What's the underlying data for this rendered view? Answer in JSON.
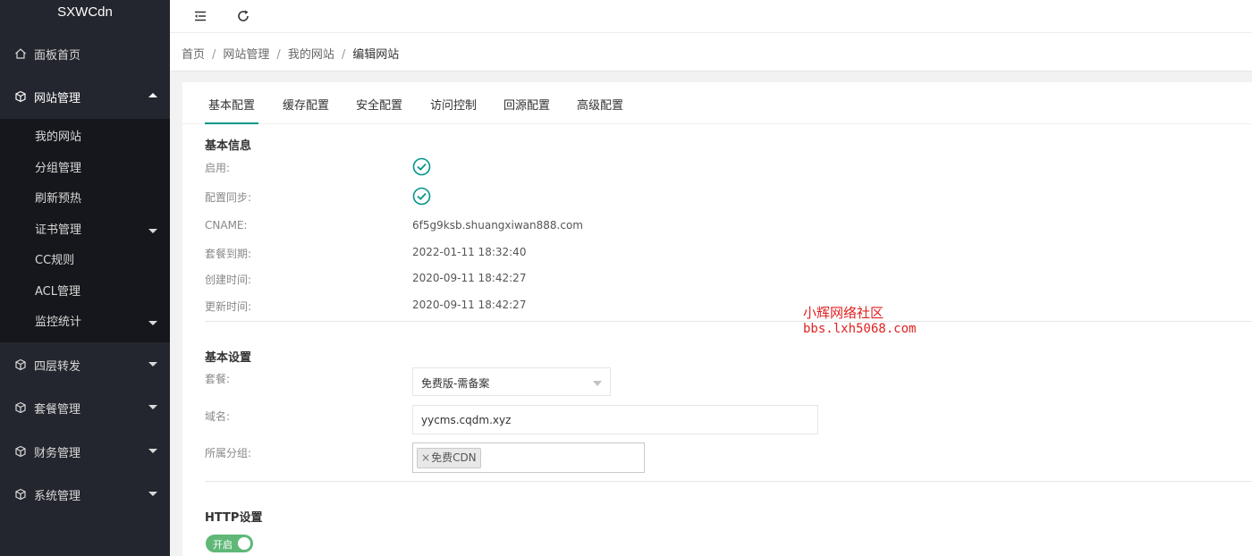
{
  "app": {
    "title": "SXWCdn"
  },
  "sidebar": {
    "items": [
      {
        "label": "面板首页",
        "icon": "home-icon"
      },
      {
        "label": "网站管理",
        "icon": "cube-icon",
        "expanded": true
      },
      {
        "label": "四层转发",
        "icon": "cube-icon"
      },
      {
        "label": "套餐管理",
        "icon": "cube-icon"
      },
      {
        "label": "财务管理",
        "icon": "cube-icon"
      },
      {
        "label": "系统管理",
        "icon": "cube-icon"
      }
    ],
    "submenu": [
      {
        "label": "我的网站"
      },
      {
        "label": "分组管理"
      },
      {
        "label": "刷新预热"
      },
      {
        "label": "证书管理",
        "has_children": true
      },
      {
        "label": "CC规则"
      },
      {
        "label": "ACL管理"
      },
      {
        "label": "监控统计",
        "has_children": true
      }
    ]
  },
  "header": {
    "icons": [
      "menu-fold-icon",
      "refresh-icon"
    ]
  },
  "breadcrumb": [
    "首页",
    "网站管理",
    "我的网站",
    "编辑网站"
  ],
  "tabs": [
    "基本配置",
    "缓存配置",
    "安全配置",
    "访问控制",
    "回源配置",
    "高级配置"
  ],
  "basic_info": {
    "title": "基本信息",
    "enabled_label": "启用:",
    "sync_label": "配置同步:",
    "cname_label": "CNAME:",
    "cname_value": "6f5g9ksb.shuangxiwan888.com",
    "expire_label": "套餐到期:",
    "expire_value": "2022-01-11 18:32:40",
    "created_label": "创建时间:",
    "created_value": "2020-09-11 18:42:27",
    "updated_label": "更新时间:",
    "updated_value": "2020-09-11 18:42:27"
  },
  "basic_settings": {
    "title": "基本设置",
    "plan_label": "套餐:",
    "plan_value": "免费版-需备案",
    "domain_label": "域名:",
    "domain_value": "yycms.cqdm.xyz",
    "group_label": "所属分组:",
    "group_tag": "免费CDN",
    "tag_remove": "×"
  },
  "http_settings": {
    "title": "HTTP设置",
    "switch_label": "开启",
    "enabled": true
  },
  "watermark": {
    "line1": "小辉网络社区",
    "line2": "bbs.lxh5068.com"
  },
  "colors": {
    "accent": "#009688",
    "switch_on": "#5fb878",
    "sidebar": "#23262e",
    "watermark": "#e02020"
  }
}
